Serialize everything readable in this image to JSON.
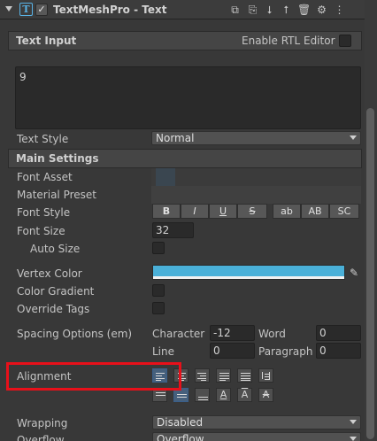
{
  "header": {
    "icon": "text-icon",
    "icon_glyph": "T",
    "enabled_check": "✓",
    "title": "TextMeshPro - Text",
    "buttons": [
      "copy-icon",
      "paste-icon",
      "arrow-down-icon",
      "arrow-up-icon",
      "trash-icon",
      "sliders-icon",
      "more-icon"
    ]
  },
  "text_input": {
    "section_title": "Text Input",
    "rtl_label": "Enable RTL Editor",
    "value": "9",
    "style_label": "Text Style",
    "style_value": "Normal"
  },
  "main_settings": {
    "section_title": "Main Settings",
    "font_asset_label": "Font Asset",
    "material_preset_label": "Material Preset",
    "font_style_label": "Font Style",
    "font_style_buttons": [
      "B",
      "I",
      "U",
      "S",
      "ab",
      "AB",
      "SC"
    ],
    "font_size_label": "Font Size",
    "font_size_value": "32",
    "auto_size_label": "Auto Size",
    "vertex_color_label": "Vertex Color",
    "vertex_color": "#4ab0d8",
    "color_gradient_label": "Color Gradient",
    "override_tags_label": "Override Tags",
    "spacing_label": "Spacing Options (em)",
    "character_label": "Character",
    "character_value": "-12",
    "word_label": "Word",
    "word_value": "0",
    "line_label": "Line",
    "line_value": "0",
    "paragraph_label": "Paragraph",
    "paragraph_value": "0",
    "alignment_label": "Alignment",
    "wrapping_label": "Wrapping",
    "wrapping_value": "Disabled",
    "overflow_label": "Overflow",
    "overflow_value": "Overflow"
  },
  "colors": {
    "accent": "#59b3e6",
    "highlight": "#e8101a",
    "panel": "#383838"
  }
}
